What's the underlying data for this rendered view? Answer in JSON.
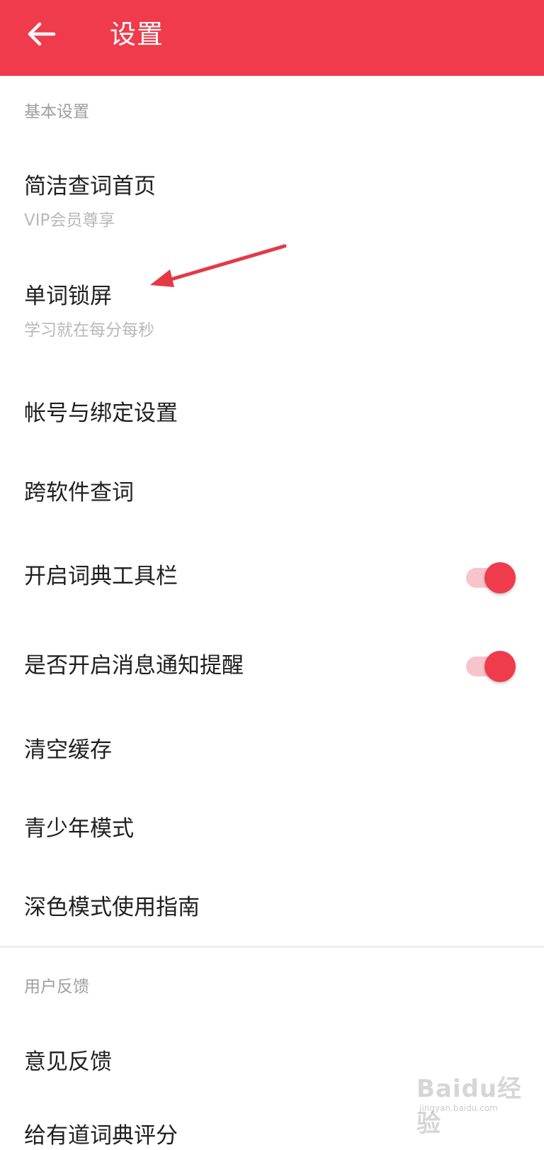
{
  "header": {
    "title": "设置",
    "back_icon": "arrow-left-icon",
    "background_color": "#ef3b4b"
  },
  "sections": [
    {
      "title": "基本设置",
      "items": [
        {
          "label": "简洁查词首页",
          "subtitle": "VIP会员尊享"
        },
        {
          "label": "单词锁屏",
          "subtitle": "学习就在每分每秒"
        },
        {
          "label": "帐号与绑定设置"
        },
        {
          "label": "跨软件查词"
        },
        {
          "label": "开启词典工具栏",
          "toggle": true
        },
        {
          "label": "是否开启消息通知提醒",
          "toggle": true
        },
        {
          "label": "清空缓存"
        },
        {
          "label": "青少年模式"
        },
        {
          "label": "深色模式使用指南"
        }
      ]
    },
    {
      "title": "用户反馈",
      "items": [
        {
          "label": "意见反馈"
        },
        {
          "label": "给有道词典评分"
        }
      ]
    }
  ],
  "watermark": {
    "logo": "Baidu经验",
    "url": "jingyan.baidu.com"
  },
  "colors": {
    "accent": "#ef3b4b",
    "toggle_track": "#f8c4cb",
    "annotation_arrow": "#e53945"
  }
}
